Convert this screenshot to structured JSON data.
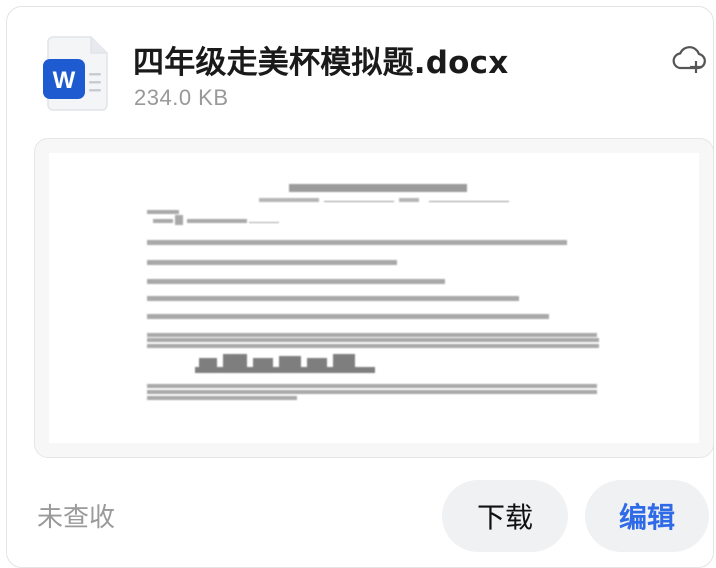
{
  "file": {
    "name": "四年级走美杯模拟题.docx",
    "size": "234.0 KB",
    "type_icon": "word-document-icon",
    "type_letter": "W"
  },
  "actions": {
    "cloud_icon": "cloud-add-icon",
    "download_label": "下载",
    "edit_label": "编辑"
  },
  "status": "未查收",
  "colors": {
    "word_blue": "#1e5bd1",
    "edit_blue": "#2f6be6",
    "button_bg": "#f0f1f3"
  }
}
